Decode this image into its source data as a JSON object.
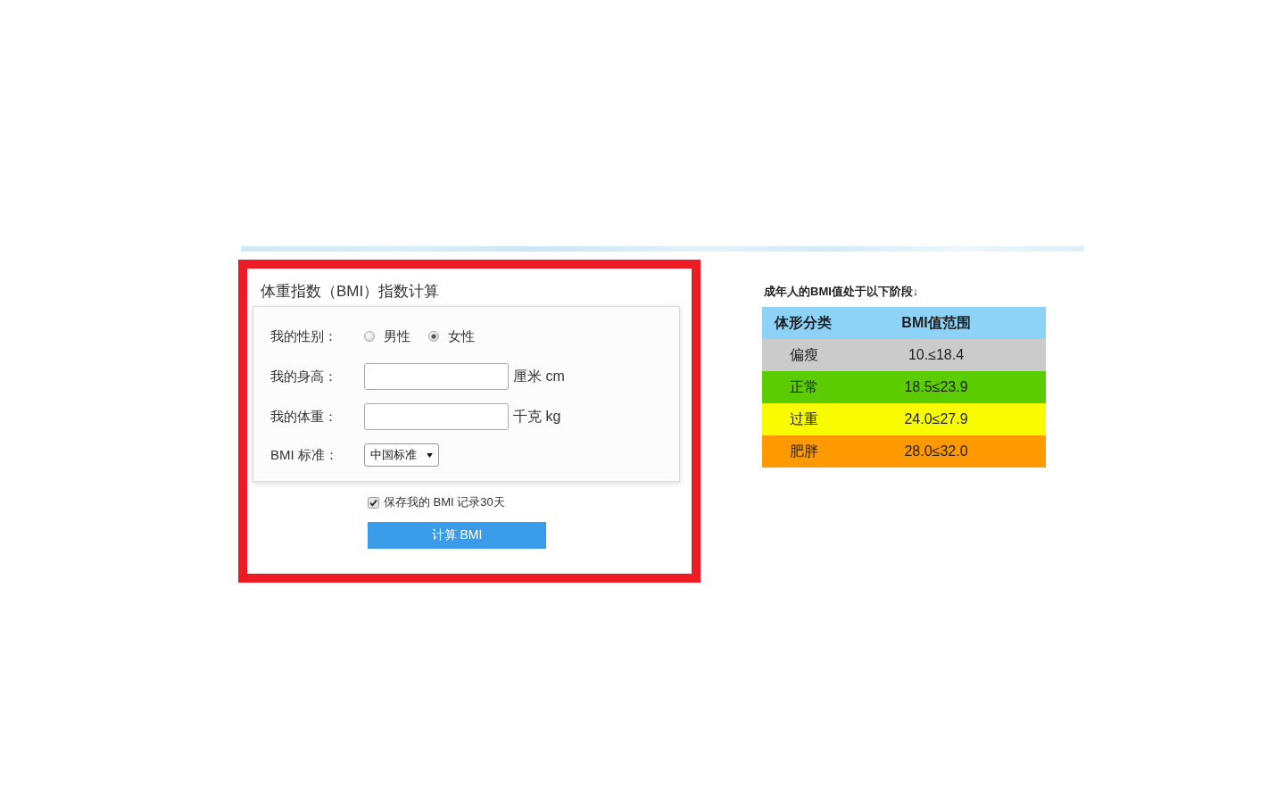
{
  "calculator": {
    "title": "体重指数（BMI）指数计算",
    "fields": [
      {
        "kind": "radio",
        "label": "我的性别：",
        "options": [
          {
            "label": "男性",
            "selected": false
          },
          {
            "label": "女性",
            "selected": true
          }
        ]
      },
      {
        "kind": "input",
        "label": "我的身高：",
        "unit": "厘米 cm"
      },
      {
        "kind": "input",
        "label": "我的体重：",
        "unit": "千克 kg"
      },
      {
        "kind": "select",
        "label": "BMI 标准：",
        "value": "中国标准"
      }
    ],
    "save_record": {
      "label": "保存我的 BMI 记录30天",
      "checked": true
    },
    "submit": "计算 BMI"
  },
  "reference": {
    "caption": "成年人的BMI值处于以下阶段↓",
    "columns": [
      "体形分类",
      "BMI值范围"
    ],
    "rows": [
      {
        "category": "偏瘦",
        "range": "10.≤18.4",
        "color": "#cbcbcb"
      },
      {
        "category": "正常",
        "range": "18.5≤23.9",
        "color": "#5bcc00"
      },
      {
        "category": "过重",
        "range": "24.0≤27.9",
        "color": "#f9fc00"
      },
      {
        "category": "肥胖",
        "range": "28.0≤32.0",
        "color": "#fe9900"
      }
    ]
  }
}
